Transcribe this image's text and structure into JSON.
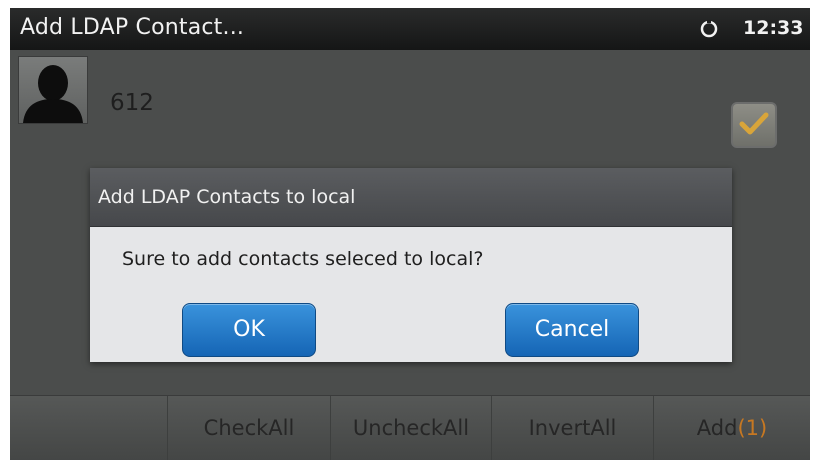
{
  "statusbar": {
    "title": "Add LDAP Contact...",
    "time": "12:33",
    "icon": "clock-icon"
  },
  "contact": {
    "name": "612",
    "avatar_icon": "person-silhouette-icon",
    "checked": true
  },
  "dialog": {
    "title": "Add LDAP Contacts to local",
    "message": "Sure to add contacts seleced to local?",
    "ok_label": "OK",
    "cancel_label": "Cancel"
  },
  "bottom_bar": {
    "checkall": "CheckAll",
    "uncheckall": "UncheckAll",
    "invertall": "InvertAll",
    "add": "Add",
    "add_count": "(1)"
  },
  "colors": {
    "accent": "#1f78c8",
    "count": "#c77822",
    "check": "#d9a53a"
  }
}
